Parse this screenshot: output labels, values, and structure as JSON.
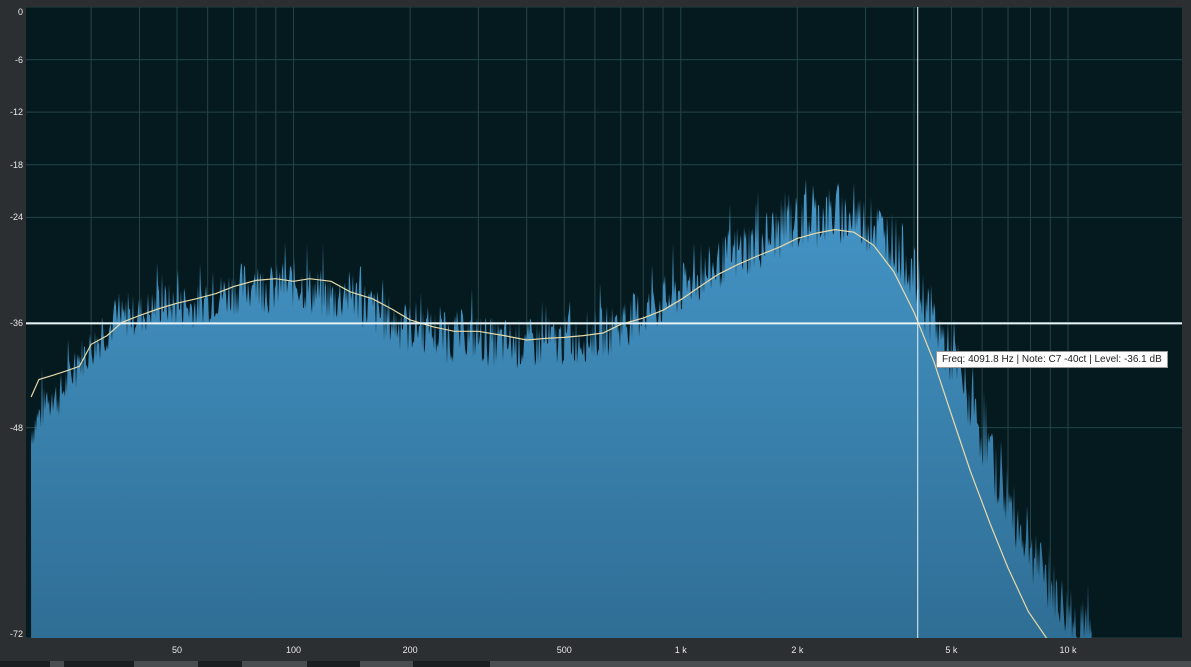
{
  "chart_data": {
    "type": "area",
    "title": "",
    "xlabel": "",
    "ylabel": "",
    "xscale": "log",
    "xlim": [
      20,
      20000
    ],
    "ylim": [
      -72,
      0
    ],
    "x_ticks": [
      {
        "value": 50,
        "label": "50"
      },
      {
        "value": 100,
        "label": "100"
      },
      {
        "value": 200,
        "label": "200"
      },
      {
        "value": 500,
        "label": "500"
      },
      {
        "value": 1000,
        "label": "1 k"
      },
      {
        "value": 2000,
        "label": "2 k"
      },
      {
        "value": 5000,
        "label": "5 k"
      },
      {
        "value": 10000,
        "label": "10 k"
      }
    ],
    "y_ticks": [
      {
        "value": 0,
        "label": "0"
      },
      {
        "value": -6,
        "label": "-6"
      },
      {
        "value": -12,
        "label": "-12"
      },
      {
        "value": -18,
        "label": "-18"
      },
      {
        "value": -24,
        "label": "-24"
      },
      {
        "value": -36,
        "label": "-36"
      },
      {
        "value": -48,
        "label": "-48"
      },
      {
        "value": -72,
        "label": "-72"
      }
    ],
    "grid": true,
    "spectrum": {
      "x": [
        21,
        23,
        25,
        28,
        31,
        34,
        38,
        42,
        46,
        50,
        55,
        60,
        65,
        70,
        76,
        82,
        88,
        95,
        102,
        110,
        118,
        127,
        136,
        146,
        157,
        168,
        180,
        195,
        210,
        230,
        250,
        275,
        300,
        330,
        360,
        400,
        440,
        490,
        540,
        600,
        660,
        730,
        800,
        880,
        970,
        1070,
        1180,
        1300,
        1430,
        1580,
        1740,
        1920,
        2120,
        2340,
        2580,
        2850,
        3150,
        3480,
        3840,
        4240,
        4680,
        5170,
        5700,
        6300,
        6950,
        7700,
        8500,
        9400,
        10400,
        11500
      ],
      "y": [
        -48,
        -45,
        -44,
        -40,
        -38,
        -36,
        -35,
        -34.5,
        -33.5,
        -34,
        -34,
        -33.5,
        -32.5,
        -32,
        -31.5,
        -31.5,
        -32,
        -31.5,
        -31,
        -32,
        -32.5,
        -33,
        -32.5,
        -33,
        -34,
        -35,
        -35.5,
        -36.5,
        -36,
        -37,
        -37.5,
        -37,
        -37.5,
        -38,
        -38,
        -38.2,
        -38,
        -37.8,
        -37.5,
        -37,
        -36.5,
        -35.5,
        -34.5,
        -33.5,
        -32.5,
        -31,
        -30,
        -28.5,
        -27.5,
        -26.5,
        -25.5,
        -24.5,
        -24,
        -23.5,
        -23.5,
        -24,
        -24.5,
        -26,
        -28.5,
        -33,
        -37,
        -41,
        -46,
        -51,
        -56,
        -60,
        -64,
        -67,
        -70,
        -72
      ]
    },
    "smoothed": {
      "x": [
        21,
        22,
        24,
        26,
        28,
        30,
        33,
        36,
        40,
        45,
        50,
        56,
        63,
        70,
        80,
        90,
        100,
        110,
        125,
        140,
        160,
        180,
        200,
        230,
        260,
        300,
        350,
        400,
        450,
        500,
        560,
        630,
        700,
        800,
        900,
        1000,
        1120,
        1250,
        1400,
        1600,
        1800,
        2000,
        2240,
        2500,
        2800,
        3150,
        3550,
        4000,
        4500,
        5000,
        5600,
        6300,
        7000,
        7900,
        8800,
        9700
      ],
      "y": [
        -44.5,
        -42.5,
        -42,
        -41.5,
        -41,
        -38.5,
        -37.5,
        -36,
        -35.2,
        -34.4,
        -33.8,
        -33.3,
        -32.7,
        -31.9,
        -31.2,
        -31,
        -31.3,
        -31,
        -31.3,
        -32.5,
        -33.3,
        -34.5,
        -35.7,
        -36.5,
        -37,
        -37,
        -37.5,
        -38,
        -37.8,
        -37.7,
        -37.5,
        -37.2,
        -36.2,
        -35.5,
        -34.6,
        -33.4,
        -31.9,
        -30.5,
        -29.4,
        -28.3,
        -27.4,
        -26.4,
        -25.8,
        -25.4,
        -25.7,
        -27.2,
        -30.2,
        -34.8,
        -40.4,
        -46.5,
        -53,
        -59,
        -64,
        -69,
        -72,
        -74
      ]
    },
    "cursor": {
      "freq": 4091.8,
      "level": -36.1
    },
    "tooltip_text": "Freq: 4091.8 Hz | Note: C7 -40ct | Level: -36.1 dB",
    "colors": {
      "background": "#051a1e",
      "spectrum_fill_top": "#4596c8",
      "spectrum_fill_bottom": "#2f6e95",
      "smoothed_line": "#e6d9a8",
      "cursor_line": "#e6f2f5",
      "grid": "#24444a"
    }
  }
}
